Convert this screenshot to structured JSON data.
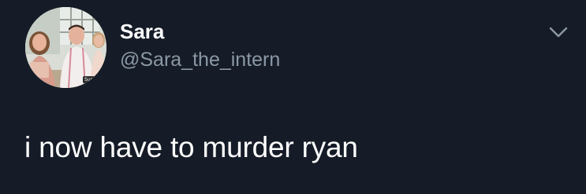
{
  "tweet": {
    "author": {
      "display_name": "Sara",
      "handle": "@Sara_the_intern",
      "avatar_icon": "profile-photo",
      "avatar_badge_text": "Sup"
    },
    "menu_icon": "chevron-down-icon",
    "text": "i now have to murder ryan"
  },
  "colors": {
    "background": "#151c27",
    "primary_text": "#ffffff",
    "secondary_text": "#8b98a5"
  }
}
